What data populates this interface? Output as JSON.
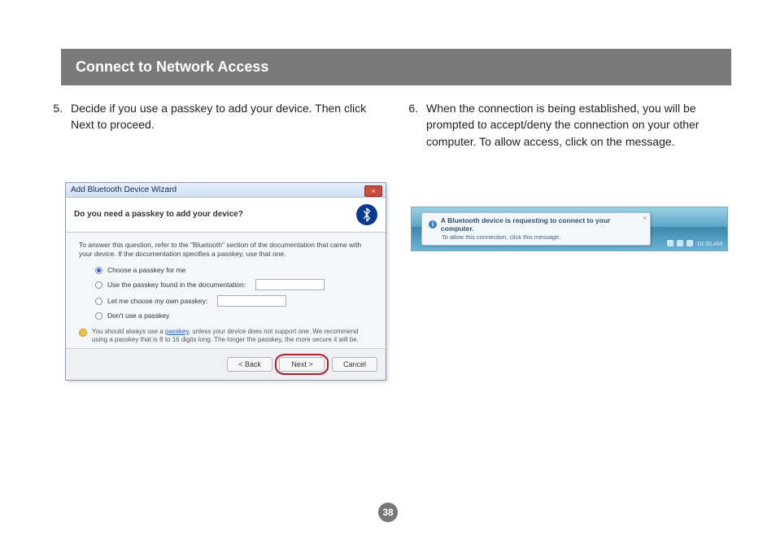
{
  "header": {
    "title": "Connect to Network Access"
  },
  "steps": {
    "left": {
      "num": "5.",
      "text": "Decide if you use a passkey to add your device. Then click Next to proceed."
    },
    "right": {
      "num": "6.",
      "text": "When the connection is being established, you will be prompted to accept/deny the connection on your other computer. To allow access, click on the message."
    }
  },
  "wizard": {
    "window_title": "Add Bluetooth Device Wizard",
    "close_glyph": "×",
    "heading": "Do you need a passkey to add your device?",
    "info": "To answer this question, refer to the \"Bluetooth\" section of the documentation that came with your device. If the documentation specifies a passkey, use that one.",
    "options": {
      "opt1": "Choose a passkey for me",
      "opt2": "Use the passkey found in the documentation:",
      "opt3": "Let me choose my own passkey:",
      "opt4": "Don't use a passkey"
    },
    "note_pre": "You should always use a ",
    "note_link": "passkey",
    "note_post": ", unless your device does not support one. We recommend using a passkey that is 8 to 16 digits long. The longer the passkey, the more secure it will be.",
    "buttons": {
      "back": "< Back",
      "next": "Next >",
      "cancel": "Cancel"
    }
  },
  "toast": {
    "title": "A Bluetooth device is requesting to connect to your computer.",
    "sub": "To allow this connection, click this message.",
    "close_glyph": "×",
    "time": "10:30 AM"
  },
  "page_number": "38"
}
